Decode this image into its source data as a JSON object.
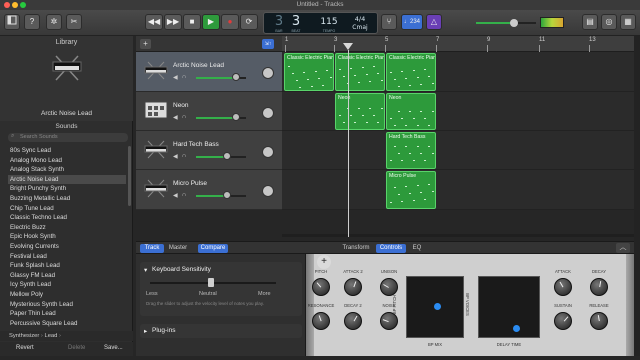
{
  "window": {
    "title": "Untitled - Tracks"
  },
  "toolbar": {
    "lcd_bar": "3",
    "lcd_beat": "3",
    "lcd_bar_label": "BAR",
    "lcd_beat_label": "BEAT",
    "lcd_tempo": "115",
    "lcd_tempo_label": "TEMPO",
    "lcd_timesig": "4/4",
    "lcd_key": "Cmaj",
    "tuner_label": "♩234",
    "accent": "#3b6fd3"
  },
  "library": {
    "title": "Library",
    "patch_name": "Arctic Noise Lead",
    "sounds_title": "Sounds",
    "search_placeholder": "Search Sounds",
    "items": [
      "80s Sync Lead",
      "Analog Mono Lead",
      "Analog Stack Synth",
      "Arctic Noise Lead",
      "Bright Punchy Synth",
      "Buzzing Metallic Lead",
      "Chip Tune Lead",
      "Classic Techno Lead",
      "Electric Buzz",
      "Epic Hook Synth",
      "Evolving Currents",
      "Festival Lead",
      "Funk Splash Lead",
      "Glassy FM Lead",
      "Icy Synth Lead",
      "Mellow Poly",
      "Mysterious Synth Lead",
      "Paper Thin Lead",
      "Percussive Square Lead"
    ],
    "selected_index": 3,
    "breadcrumb_1": "Synthesizer",
    "breadcrumb_2": "Lead",
    "revert_label": "Revert",
    "delete_label": "Delete",
    "save_label": "Save..."
  },
  "tracks": [
    {
      "name": "Arctic Noise Lead",
      "volume": 0.8,
      "selected": true
    },
    {
      "name": "Neon",
      "volume": 0.8,
      "selected": false
    },
    {
      "name": "Hard Tech Bass",
      "volume": 0.62,
      "selected": false
    },
    {
      "name": "Micro Pulse",
      "volume": 0.62,
      "selected": false
    }
  ],
  "ruler": {
    "bars": [
      "1",
      "3",
      "5",
      "7",
      "9",
      "11",
      "13"
    ]
  },
  "regions": [
    {
      "label": "Classic Electric Pian",
      "track": 0
    },
    {
      "label": "Classic Electric Pian",
      "track": 0
    },
    {
      "label": "Classic Electric Pian",
      "track": 0
    },
    {
      "label": "Neon",
      "track": 1
    },
    {
      "label": "Neon",
      "track": 1
    },
    {
      "label": "Hard Tech Bass",
      "track": 2
    },
    {
      "label": "Micro Pulse",
      "track": 3
    }
  ],
  "editor": {
    "tab_track": "Track",
    "tab_master": "Master",
    "tab_compare": "Compare",
    "tab_transform": "Transform",
    "tab_controls": "Controls",
    "tab_eq": "EQ",
    "keyboard_sensitivity_title": "Keyboard Sensitivity",
    "sens_less": "Less",
    "sens_neutral": "Neutral",
    "sens_more": "More",
    "sens_help": "Drag the slider to adjust the velocity level of notes you play.",
    "plugins_title": "Plug-ins"
  },
  "synth": {
    "knobs": [
      {
        "label": "PITCH"
      },
      {
        "label": "ATTACK 2"
      },
      {
        "label": "UNISON"
      },
      {
        "label": "RESONANCE"
      },
      {
        "label": "DECAY 2"
      },
      {
        "label": "NOISE"
      },
      {
        "label": "ATTACK"
      },
      {
        "label": "DECAY"
      },
      {
        "label": "SUSTAIN"
      },
      {
        "label": "RELEASE"
      }
    ],
    "pad1_x_label": "BP MIX",
    "pad1_y_label": "BP PITCH",
    "pad2_x_label": "DELAY TIME",
    "pad2_y_label": "BP VOICES"
  }
}
